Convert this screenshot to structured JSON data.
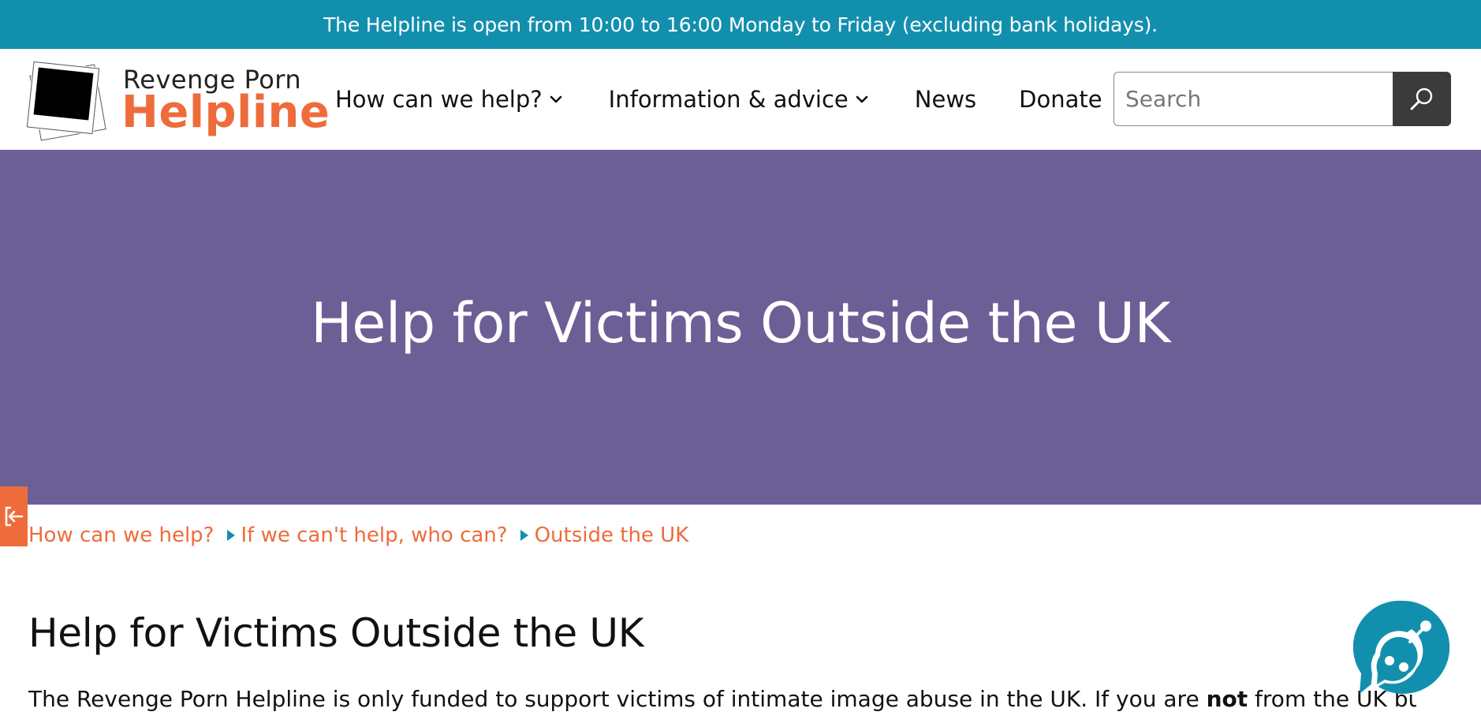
{
  "announcement": {
    "text": "The Helpline is open from 10:00 to 16:00 Monday to Friday (excluding bank holidays)."
  },
  "logo": {
    "line1": "Revenge Porn",
    "line2": "Helpline",
    "accent_color": "#ee6c3c"
  },
  "nav": {
    "items": [
      {
        "label": "How can we help?",
        "has_dropdown": true
      },
      {
        "label": "Information & advice",
        "has_dropdown": true
      },
      {
        "label": "News",
        "has_dropdown": false
      },
      {
        "label": "Donate",
        "has_dropdown": false
      }
    ]
  },
  "search": {
    "placeholder": "Search",
    "value": "",
    "button_icon": "search-icon"
  },
  "hero": {
    "title": "Help for Victims Outside the UK",
    "background_color": "#6c5f96"
  },
  "side_tab": {
    "icon": "exit-arrow-icon",
    "color": "#ee6c3c"
  },
  "breadcrumb": {
    "items": [
      {
        "label": "How can we help?"
      },
      {
        "label": "If we can't help, who can?"
      },
      {
        "label": "Outside the UK"
      }
    ]
  },
  "main": {
    "heading": "Help for Victims Outside the UK",
    "paragraph_before": "The Revenge Porn Helpline is only funded to support victims of intimate image abuse in the UK. If you are ",
    "paragraph_bold": "not",
    "paragraph_after": " from the UK but"
  },
  "chat": {
    "icon": "chat-bubble-icon",
    "color": "#138fae"
  },
  "colors": {
    "topbar": "#138fae",
    "breadcrumb_link": "#ee6c3c",
    "breadcrumb_separator": "#138fae",
    "search_button": "#3b3b3b"
  }
}
